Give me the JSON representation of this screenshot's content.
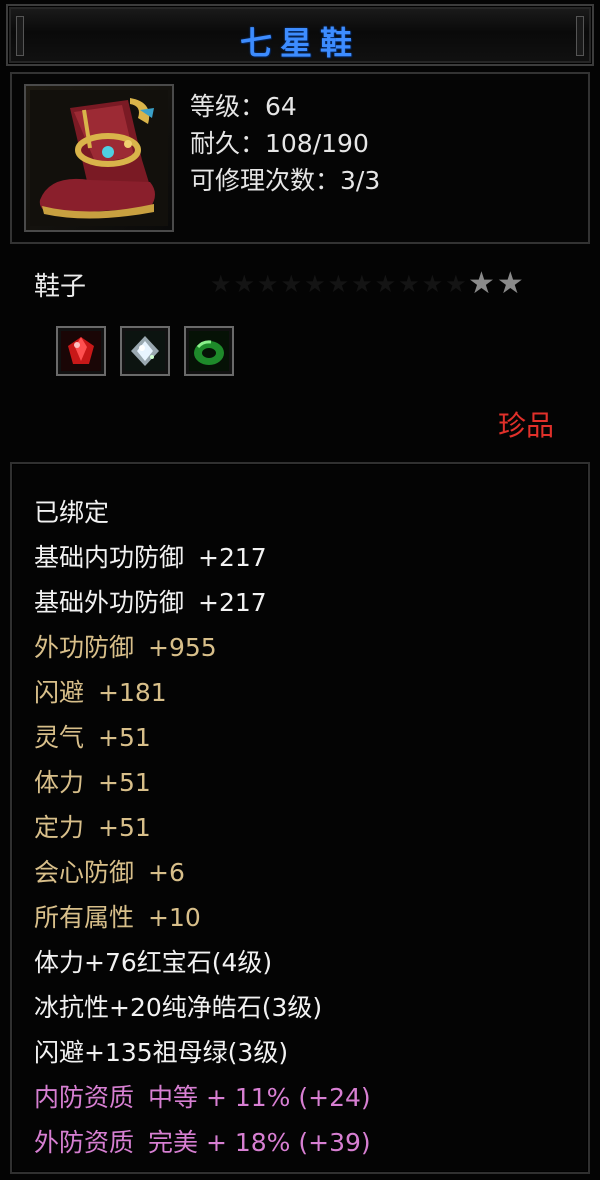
{
  "item": {
    "name": "七星鞋",
    "level": "等级：64",
    "durability": "耐久：108/190",
    "repairs": "可修理次数：3/3",
    "type": "鞋子",
    "stars": "★★",
    "quality": "珍品",
    "gems": [
      "ruby-gem-icon",
      "diamond-gem-icon",
      "emerald-gem-icon"
    ]
  },
  "attributes": [
    {
      "name": "已绑定",
      "value": "",
      "color": "white"
    },
    {
      "name": "基础内功防御",
      "value": "+217",
      "color": "white"
    },
    {
      "name": "基础外功防御",
      "value": "+217",
      "color": "white"
    },
    {
      "name": "外功防御",
      "value": "+955",
      "color": "gold"
    },
    {
      "name": "闪避",
      "value": "+181",
      "color": "gold"
    },
    {
      "name": "灵气",
      "value": "+51",
      "color": "gold"
    },
    {
      "name": "体力",
      "value": "+51",
      "color": "gold"
    },
    {
      "name": "定力",
      "value": "+51",
      "color": "gold"
    },
    {
      "name": "会心防御",
      "value": "+6",
      "color": "gold"
    },
    {
      "name": "所有属性",
      "value": "+10",
      "color": "gold"
    },
    {
      "name": "体力+76红宝石(4级)",
      "value": "",
      "color": "white"
    },
    {
      "name": "冰抗性+20纯净皓石(3级)",
      "value": "",
      "color": "white"
    },
    {
      "name": "闪避+135祖母绿(3级)",
      "value": "",
      "color": "white"
    },
    {
      "name": "内防资质",
      "value": "中等  +  11%  (+24)",
      "color": "pink"
    },
    {
      "name": "外防资质",
      "value": "完美  +  18%  (+39)",
      "color": "pink"
    }
  ],
  "colors": {
    "title": "#3d8cff",
    "quality": "#e0302a",
    "white": "#f2f2f2",
    "gold": "#d8bf8a",
    "pink": "#d77fd2"
  }
}
